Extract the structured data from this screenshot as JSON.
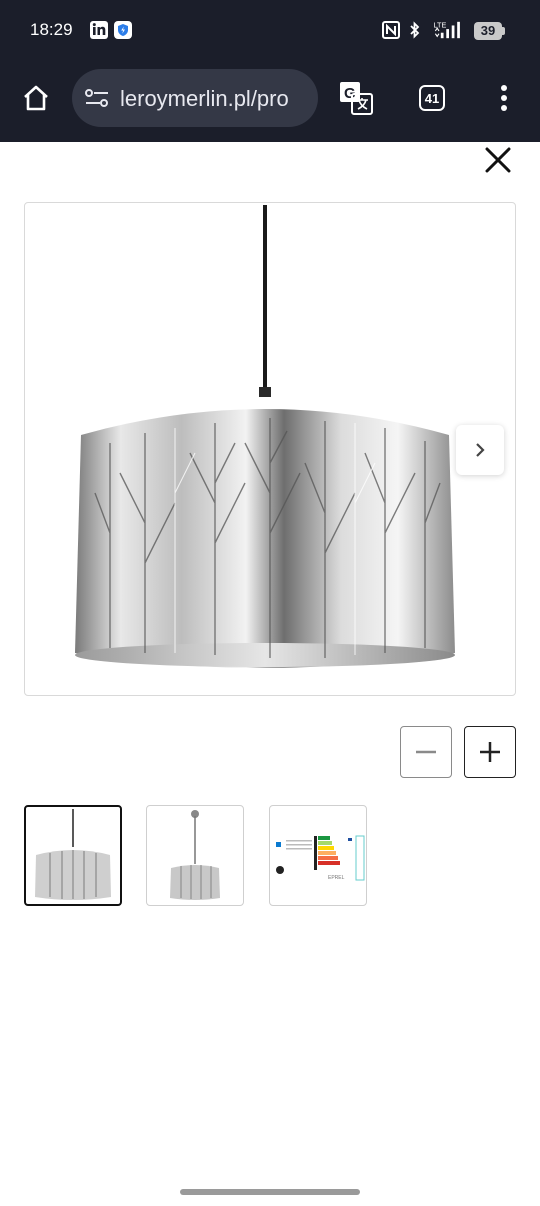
{
  "status_bar": {
    "time": "18:29",
    "battery_level": "39",
    "network_label": "LTE",
    "icons": [
      "linkedin-icon",
      "shield-app-icon",
      "nfc-icon",
      "bluetooth-icon",
      "signal-icon",
      "battery-icon"
    ]
  },
  "browser": {
    "url": "leroymerlin.pl/pro",
    "tab_count": "41",
    "icons": [
      "home-icon",
      "site-settings-icon",
      "translate-icon",
      "tabs-icon",
      "more-menu-icon"
    ]
  },
  "gallery": {
    "main_image_alt": "pendant-lamp-photo",
    "thumbnail_count": 3,
    "active_thumbnail": 1,
    "energy_label_text": "EPREL"
  },
  "colors": {
    "browser_chrome": "#1b1e2a",
    "url_pill": "#343846",
    "border": "#d9d9d9"
  }
}
